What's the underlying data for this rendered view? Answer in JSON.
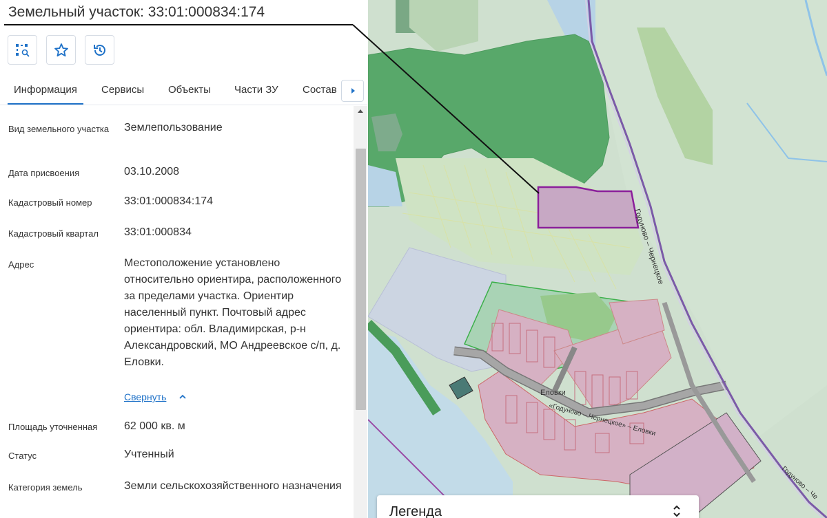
{
  "title": "Земельный участок: 33:01:000834:174",
  "toolbar": {
    "buttons": [
      {
        "icon": "area-search-icon"
      },
      {
        "icon": "star-icon"
      },
      {
        "icon": "history-icon"
      }
    ]
  },
  "tabs": [
    "Информация",
    "Сервисы",
    "Объекты",
    "Части ЗУ",
    "Состав"
  ],
  "active_tab": "Информация",
  "info": {
    "land_type_label": "Вид земельного участка",
    "land_type_value": "Землепользование",
    "date_label": "Дата присвоения",
    "date_value": "03.10.2008",
    "cad_number_label": "Кадастровый номер",
    "cad_number_value": "33:01:000834:174",
    "cad_quarter_label": "Кадастровый квартал",
    "cad_quarter_value": "33:01:000834",
    "address_label": "Адрес",
    "address_value": "Местоположение установлено относительно ориентира, расположенного за пределами участка. Ориентир населенный пункт. Почтовый адрес ориентира: обл. Владимирская, р-н Александровский, МО Андреевское с/п, д. Еловки.",
    "collapse_label": "Свернуть",
    "area_label": "Площадь уточненная",
    "area_value": "62 000 кв. м",
    "status_label": "Статус",
    "status_value": "Учтенный",
    "category_label": "Категория земель",
    "category_value": "Земли сельскохозяйственного назначения"
  },
  "map": {
    "labels": {
      "road_1": "Годуново – Чернецкое",
      "village": "Еловки",
      "road_2": "«Годуново – Чернецкое» – Еловки",
      "road_3": "Годуново – Че"
    },
    "colors": {
      "parcel_fill": "#c7a8c4",
      "parcel_stroke": "#8b1f9b",
      "forest": "#5aa96c",
      "road": "#a6a6a6"
    }
  },
  "legend": {
    "label": "Легенда"
  },
  "colors": {
    "accent": "#1f72c8"
  }
}
